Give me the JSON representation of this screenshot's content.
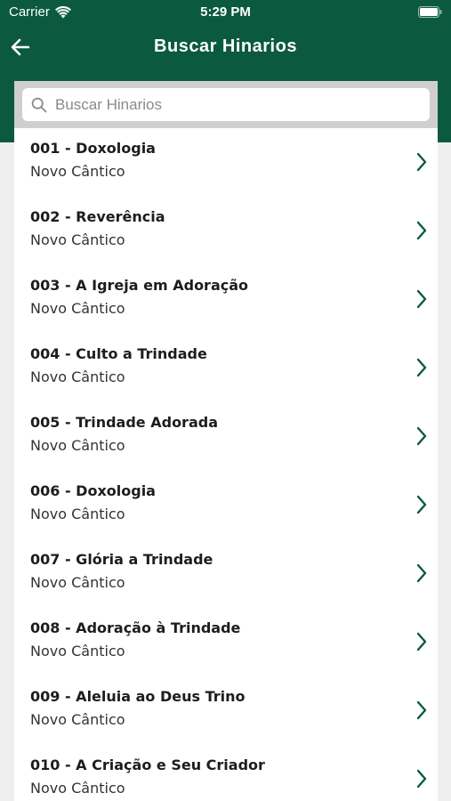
{
  "status_bar": {
    "carrier": "Carrier",
    "time": "5:29 PM",
    "icons": [
      "wifi-icon",
      "battery-icon"
    ]
  },
  "nav": {
    "back_icon": "arrow-left-icon",
    "title": "Buscar Hinarios"
  },
  "search": {
    "icon": "search-icon",
    "placeholder": "Buscar Hinarios",
    "value": ""
  },
  "hymns": [
    {
      "title": "001 - Doxologia",
      "hymnal": "Novo Cântico"
    },
    {
      "title": "002 - Reverência",
      "hymnal": "Novo Cântico"
    },
    {
      "title": "003 - A Igreja em Adoração",
      "hymnal": "Novo Cântico"
    },
    {
      "title": "004 - Culto a Trindade",
      "hymnal": "Novo Cântico"
    },
    {
      "title": "005 - Trindade Adorada",
      "hymnal": "Novo Cântico"
    },
    {
      "title": "006 - Doxologia",
      "hymnal": "Novo Cântico"
    },
    {
      "title": "007 - Glória a Trindade",
      "hymnal": "Novo Cântico"
    },
    {
      "title": "008 - Adoração à Trindade",
      "hymnal": "Novo Cântico"
    },
    {
      "title": "009 - Aleluia ao Deus Trino",
      "hymnal": "Novo Cântico"
    },
    {
      "title": "010 - A Criação e Seu Criador",
      "hymnal": "Novo Cântico"
    }
  ],
  "colors": {
    "brand": "#0b5a40",
    "chevron": "#0b5a40",
    "background": "#efefef",
    "search_bar": "#cfcfcf"
  }
}
